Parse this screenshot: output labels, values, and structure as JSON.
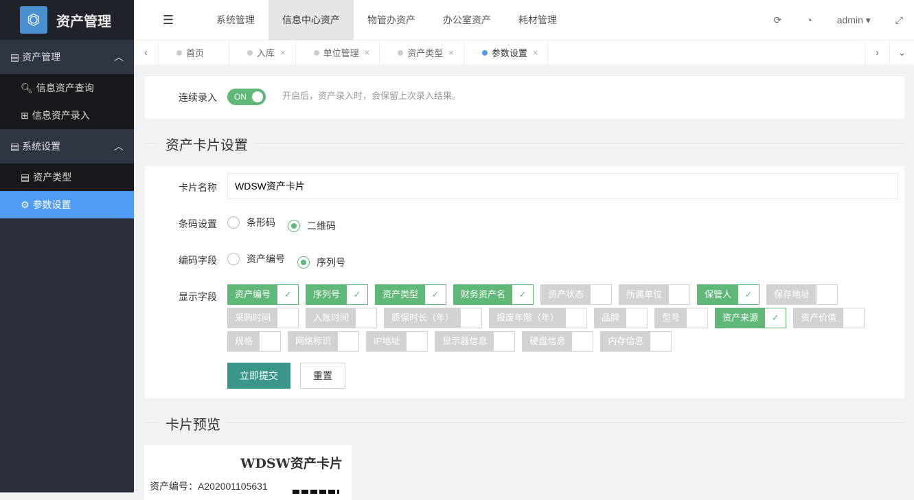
{
  "app": {
    "title": "资产管理"
  },
  "sidebar": {
    "groups": [
      {
        "label": "资产管理",
        "items": [
          {
            "icon": "search-icon",
            "glyph": "🔍︎",
            "label": "信息资产查询"
          },
          {
            "icon": "plus-square-icon",
            "glyph": "⊞",
            "label": "信息资产录入"
          }
        ]
      },
      {
        "label": "系统设置",
        "items": [
          {
            "icon": "card-icon",
            "glyph": "▤",
            "label": "资产类型"
          },
          {
            "icon": "gear-icon",
            "glyph": "⚙",
            "label": "参数设置",
            "active": true
          }
        ]
      }
    ]
  },
  "topnav": {
    "items": [
      "系统管理",
      "信息中心资产",
      "物管办资产",
      "办公室资产",
      "耗材管理"
    ],
    "active": 1,
    "user": "admin"
  },
  "tabs": [
    {
      "label": "首页",
      "closable": false
    },
    {
      "label": "入库",
      "closable": true
    },
    {
      "label": "单位管理",
      "closable": true
    },
    {
      "label": "资产类型",
      "closable": true
    },
    {
      "label": "参数设置",
      "closable": true,
      "active": true
    }
  ],
  "continuous": {
    "label": "连续录入",
    "toggle": "ON",
    "hint": "开启后，资产录入时，会保留上次录入结果。"
  },
  "card_settings": {
    "title": "资产卡片设置",
    "name_label": "卡片名称",
    "name_value": "WDSW资产卡片",
    "barcode_label": "条码设置",
    "barcode_options": [
      "条形码",
      "二维码"
    ],
    "barcode_selected": 1,
    "code_label": "编码字段",
    "code_options": [
      "资产编号",
      "序列号"
    ],
    "code_selected": 1,
    "fields_label": "显示字段",
    "fields": [
      {
        "label": "资产编号",
        "on": true
      },
      {
        "label": "序列号",
        "on": true
      },
      {
        "label": "资产类型",
        "on": true
      },
      {
        "label": "财务资产名",
        "on": true
      },
      {
        "label": "资产状态",
        "on": false
      },
      {
        "label": "所属单位",
        "on": false
      },
      {
        "label": "保管人",
        "on": true
      },
      {
        "label": "保存地址",
        "on": false
      },
      {
        "label": "采购时间",
        "on": false
      },
      {
        "label": "入账时间",
        "on": false
      },
      {
        "label": "质保时长（年）",
        "on": false
      },
      {
        "label": "报废年限（年）",
        "on": false
      },
      {
        "label": "品牌",
        "on": false
      },
      {
        "label": "型号",
        "on": false
      },
      {
        "label": "资产来源",
        "on": true
      },
      {
        "label": "资产价值",
        "on": false
      },
      {
        "label": "规格",
        "on": false
      },
      {
        "label": "网络标识",
        "on": false
      },
      {
        "label": "IP地址",
        "on": false
      },
      {
        "label": "显示器信息",
        "on": false
      },
      {
        "label": "硬盘信息",
        "on": false
      },
      {
        "label": "内存信息",
        "on": false
      }
    ],
    "submit": "立即提交",
    "reset": "重置"
  },
  "preview": {
    "title": "卡片预览",
    "card_title": "WDSW资产卡片",
    "line1": "资产编号：A202001105631"
  }
}
